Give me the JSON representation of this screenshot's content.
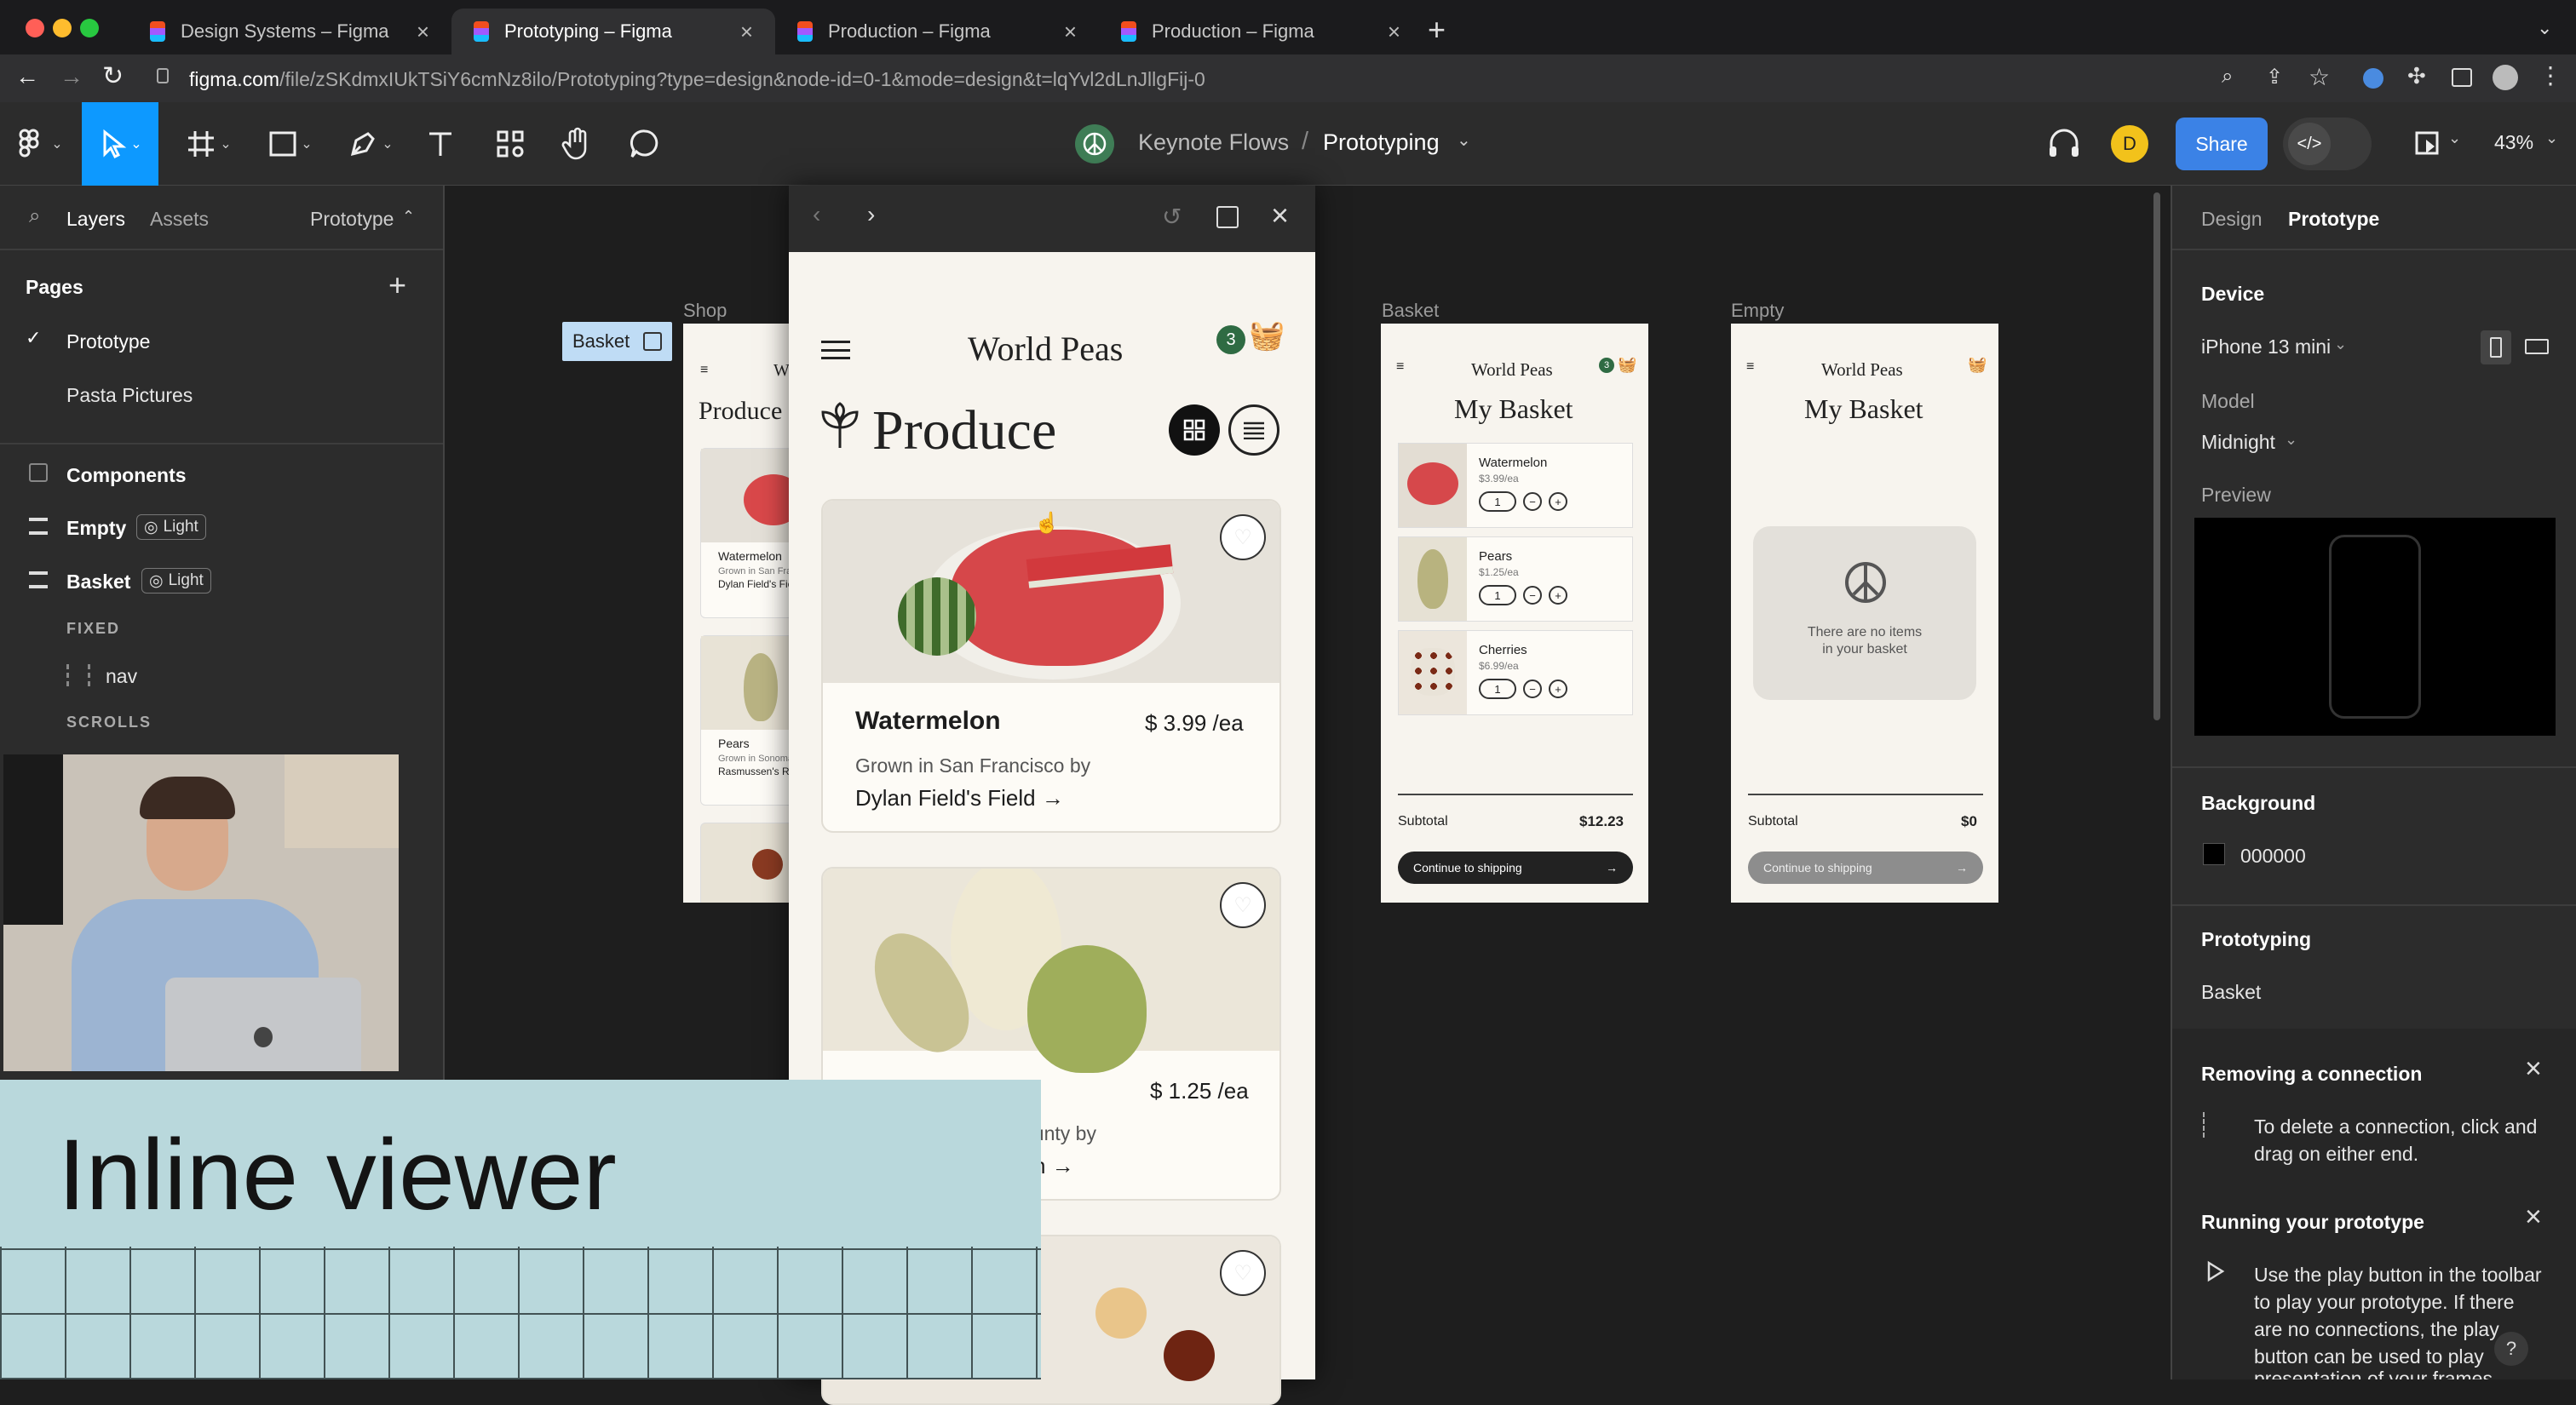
{
  "browser": {
    "tabs": [
      {
        "title": "Design Systems – Figma"
      },
      {
        "title": "Prototyping – Figma"
      },
      {
        "title": "Production – Figma"
      },
      {
        "title": "Production – Figma"
      }
    ],
    "url_domain": "figma.com",
    "url_path": "/file/zSKdmxIUkTSiY6cmNz8ilo/Prototyping?type=design&node-id=0-1&mode=design&t=lqYvl2dLnJllgFij-0"
  },
  "figma": {
    "project": "Keynote Flows",
    "separator": "/",
    "file": "Prototyping",
    "avatar_initial": "D",
    "share_label": "Share",
    "zoom": "43%"
  },
  "left_panel": {
    "tab_layers": "Layers",
    "tab_assets": "Assets",
    "page_dropdown": "Prototype",
    "pages_heading": "Pages",
    "pages": [
      {
        "label": "Prototype",
        "checked": true
      },
      {
        "label": "Pasta Pictures",
        "checked": false
      }
    ],
    "layers": [
      {
        "label": "Components"
      },
      {
        "label": "Empty",
        "badge": "Light"
      },
      {
        "label": "Basket",
        "badge": "Light"
      }
    ],
    "fixed_label": "FIXED",
    "nav_label": "nav",
    "scrolls_label": "SCROLLS"
  },
  "canvas": {
    "shop_label": "Shop",
    "basket_label": "Basket",
    "empty_label": "Empty",
    "flow_tag": "Basket",
    "shop_preview": {
      "title": "World Peas",
      "heading": "Produce",
      "items": [
        {
          "name": "Watermelon",
          "line1": "Grown in San Francisco by",
          "line2": "Dylan Field's Field"
        },
        {
          "name": "Pears",
          "line1": "Grown in Sonoma County by",
          "line2": "Rasmussen's Ranch"
        }
      ]
    },
    "basket_frame": {
      "brand": "World Peas",
      "badge": "3",
      "title": "My Basket",
      "items": [
        {
          "name": "Watermelon",
          "price": "$3.99/ea",
          "qty": "1"
        },
        {
          "name": "Pears",
          "price": "$1.25/ea",
          "qty": "1"
        },
        {
          "name": "Cherries",
          "price": "$6.99/ea",
          "qty": "1"
        }
      ],
      "subtotal_label": "Subtotal",
      "subtotal_value": "$12.23",
      "cta": "Continue to shipping"
    },
    "empty_frame": {
      "brand": "World Peas",
      "title": "My Basket",
      "empty_line1": "There are no items",
      "empty_line2": "in your basket",
      "subtotal_label": "Subtotal",
      "subtotal_value": "$0",
      "cta": "Continue to shipping"
    }
  },
  "viewer": {
    "brand": "World Peas",
    "badge": "3",
    "heading": "Produce",
    "cards": [
      {
        "name": "Watermelon",
        "price": "$ 3.99 /ea",
        "line1": "Grown in San Francisco by",
        "line2": "Dylan Field's Field →"
      },
      {
        "name": "",
        "price": "$ 1.25 /ea",
        "line1": "ounty by",
        "line2": "ch →"
      }
    ]
  },
  "right_panel": {
    "tab_design": "Design",
    "tab_prototype": "Prototype",
    "device_heading": "Device",
    "device_value": "iPhone 13 mini",
    "model_label": "Model",
    "model_value": "Midnight",
    "preview_label": "Preview",
    "background_heading": "Background",
    "background_hex": "000000",
    "prototyping_heading": "Prototyping",
    "prototyping_value": "Basket",
    "notice1_title": "Removing a connection",
    "notice1_line1": "To delete a connection, click and",
    "notice1_line2": "drag on either end.",
    "notice2_title": "Running your prototype",
    "notice2_line1": "Use the play button in the toolbar",
    "notice2_line2": "to play your prototype. If there",
    "notice2_line3": "are no connections, the play",
    "notice2_line4": "button can be used to play",
    "notice2_line5": "presentation of your frames.",
    "help": "?"
  },
  "overlay": {
    "title": "Inline viewer"
  },
  "colors": {
    "accent": "#0d99ff",
    "share": "#3b82e6",
    "avatar": "#f2c21b",
    "badge_green": "#2f6b43"
  }
}
